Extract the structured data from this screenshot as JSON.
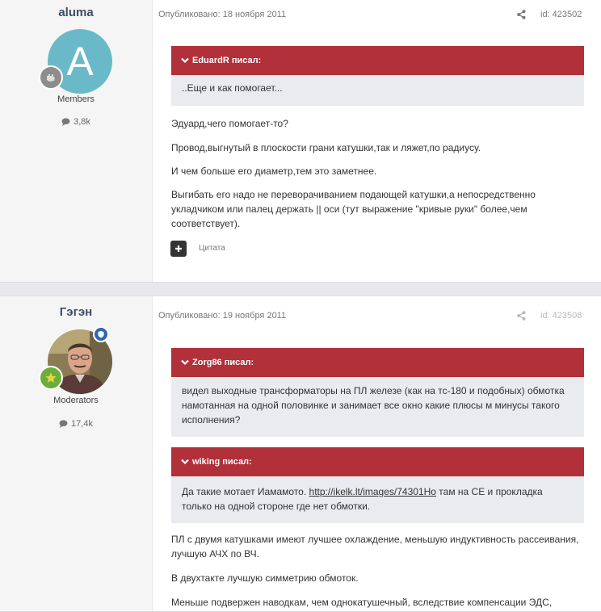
{
  "posts": [
    {
      "author": "aluma",
      "avatar_letter": "A",
      "group": "Members",
      "reputation": "3,8k",
      "date": "Опубликовано: 18 ноября 2011",
      "post_id": "id: 423502",
      "quotes": [
        {
          "author": "EduardR писал:",
          "text": "..Еще и как помогает..."
        }
      ],
      "paragraphs": [
        "Эдуард,чего помогает-то?",
        "Провод,выгнутый в плоскости грани катушки,так и ляжет,по радиусу.",
        "И чем больше его диаметр,тем это заметнее.",
        "Выгибать его надо не переворачиванием подающей катушки,а непосредственно укладчиком или палец держать || оси (тут выражение \"кривые руки\" более,чем соответствует)."
      ],
      "quote_button": "Цитата"
    },
    {
      "author": "Гэгэн",
      "group": "Moderators",
      "reputation": "17,4k",
      "date": "Опубликовано: 19 ноября 2011",
      "post_id": "id: 423508",
      "quotes": [
        {
          "author": "Zorg86 писал:",
          "text": "видел выходные трансформаторы на ПЛ железе (как на тс-180 и подобных) обмотка намотанная на одной половинке и занимает все окно какие плюсы м минусы такого исполнения?"
        },
        {
          "author": "wiking писал:",
          "text_before": "Да такие мотает Иамамото. ",
          "link": "http://ikelk.lt/images/74301Ho",
          "text_after": " там на СЕ и прокладка только на одной стороне где нет обмотки."
        }
      ],
      "paragraphs": [
        "ПЛ с двумя катушками имеют лучшее охлаждение, меньшую индуктивность рассеивания, лучшую АЧХ по ВЧ.",
        "В двухтакте лучшую симметрию обмоток.",
        "Меньше подвержен наводкам, чем однокатушечный, вследствие компенсации ЭДС,"
      ]
    }
  ],
  "colors": {
    "accent": "#b13039",
    "avatar_bg": "#6ab9c9",
    "moderator_badge": "#2d67b2",
    "rank_star": "#6cad3a"
  }
}
